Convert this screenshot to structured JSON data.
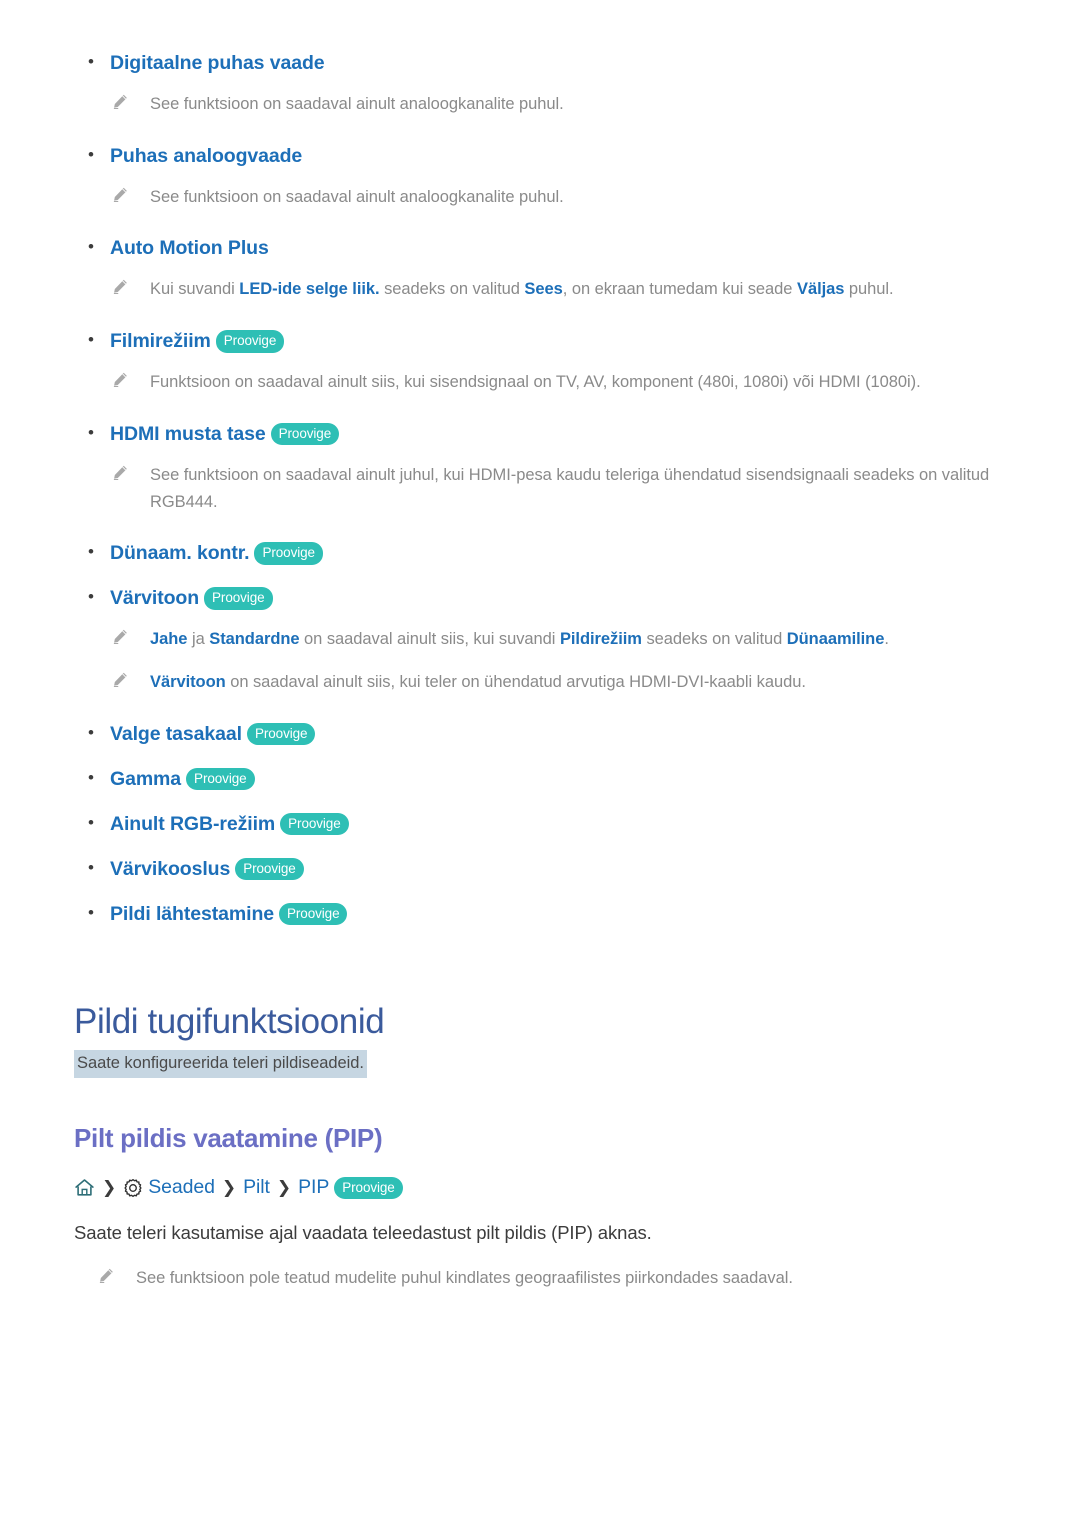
{
  "colors": {
    "link_blue": "#1d6fb8",
    "pill_teal": "#2ebfb5",
    "title_blue": "#3a5a9c",
    "section_purple": "#6b6fc4",
    "highlight_bg": "#c6d6e2",
    "note_gray": "#8a8a8a",
    "body_text": "#3c3c3c"
  },
  "pill_label": "Proovige",
  "bullet_glyph": "•",
  "items": [
    {
      "label": "Digitaalne puhas vaade",
      "has_pill": false,
      "notes": [
        {
          "parts": [
            {
              "t": "See funktsioon on saadaval ainult analoogkanalite puhul.",
              "b": false
            }
          ]
        }
      ]
    },
    {
      "label": "Puhas analoogvaade",
      "has_pill": false,
      "notes": [
        {
          "parts": [
            {
              "t": "See funktsioon on saadaval ainult analoogkanalite puhul.",
              "b": false
            }
          ]
        }
      ]
    },
    {
      "label": "Auto Motion Plus",
      "has_pill": false,
      "notes": [
        {
          "parts": [
            {
              "t": "Kui suvandi ",
              "b": false
            },
            {
              "t": "LED-ide selge liik.",
              "b": true
            },
            {
              "t": " seadeks on valitud ",
              "b": false
            },
            {
              "t": "Sees",
              "b": true
            },
            {
              "t": ", on ekraan tumedam kui seade ",
              "b": false
            },
            {
              "t": "Väljas",
              "b": true
            },
            {
              "t": " puhul.",
              "b": false
            }
          ]
        }
      ]
    },
    {
      "label": "Filmirežiim",
      "has_pill": true,
      "notes": [
        {
          "parts": [
            {
              "t": "Funktsioon on saadaval ainult siis, kui sisendsignaal on TV, AV, komponent (480i, 1080i) või HDMI (1080i).",
              "b": false
            }
          ]
        }
      ]
    },
    {
      "label": "HDMI musta tase",
      "has_pill": true,
      "notes": [
        {
          "parts": [
            {
              "t": "See funktsioon on saadaval ainult juhul, kui HDMI-pesa kaudu teleriga ühendatud sisendsignaali seadeks on valitud RGB444.",
              "b": false
            }
          ]
        }
      ]
    },
    {
      "label": "Dünaam. kontr.",
      "has_pill": true,
      "notes": []
    },
    {
      "label": "Värvitoon",
      "has_pill": true,
      "notes": [
        {
          "parts": [
            {
              "t": "Jahe",
              "b": true
            },
            {
              "t": " ja ",
              "b": false
            },
            {
              "t": "Standardne",
              "b": true
            },
            {
              "t": " on saadaval ainult siis, kui suvandi ",
              "b": false
            },
            {
              "t": "Pildirežiim",
              "b": true
            },
            {
              "t": " seadeks on valitud ",
              "b": false
            },
            {
              "t": "Dünaamiline",
              "b": true
            },
            {
              "t": ".",
              "b": false
            }
          ]
        },
        {
          "parts": [
            {
              "t": "Värvitoon",
              "b": true
            },
            {
              "t": " on saadaval ainult siis, kui teler on ühendatud arvutiga HDMI-DVI-kaabli kaudu.",
              "b": false
            }
          ]
        }
      ]
    },
    {
      "label": "Valge tasakaal",
      "has_pill": true,
      "notes": []
    },
    {
      "label": "Gamma",
      "has_pill": true,
      "notes": []
    },
    {
      "label": "Ainult RGB-režiim",
      "has_pill": true,
      "notes": []
    },
    {
      "label": "Värvikooslus",
      "has_pill": true,
      "notes": []
    },
    {
      "label": "Pildi lähtestamine",
      "has_pill": true,
      "notes": []
    }
  ],
  "chapter": {
    "title": "Pildi tugifunktsioonid",
    "subtitle": "Saate konfigureerida teleri pildiseadeid."
  },
  "section": {
    "title": "Pilt pildis vaatamine (PIP)",
    "breadcrumb": {
      "home_icon": "home-icon",
      "separator": "❯",
      "gear_icon": "gear-icon",
      "crumbs": [
        "Seaded",
        "Pilt",
        "PIP"
      ],
      "pill": "Proovige"
    },
    "paragraph": "Saate teleri kasutamise ajal vaadata teleedastust pilt pildis (PIP) aknas.",
    "note": "See funktsioon pole teatud mudelite puhul kindlates geograafilistes piirkondades saadaval."
  }
}
